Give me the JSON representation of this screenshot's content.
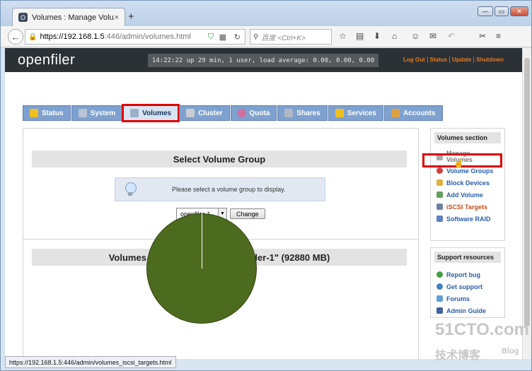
{
  "browser": {
    "tab_title": "Volumes : Manage Volu...",
    "tab_close": "×",
    "new_tab": "+",
    "url_host": "https://192.168.1.5",
    "url_path": ":446/admin/volumes.html",
    "search_placeholder": "百度 <Ctrl+K>",
    "status_url": "https://192.168.1.5:446/admin/volumes_iscsi_targets.html"
  },
  "header": {
    "logo": "openfiler",
    "uptime": "14:22:22 up 29 min, 1 user, load average: 0.00, 0.00, 0.00",
    "links": [
      "Log Out",
      "Status",
      "Update",
      "Shutdown"
    ]
  },
  "tabs": [
    {
      "label": "Status",
      "icon": "sun-icon",
      "color": "#f0c020"
    },
    {
      "label": "System",
      "icon": "computer-icon",
      "color": "#b8c4d4"
    },
    {
      "label": "Volumes",
      "icon": "disk-icon",
      "color": "#9ab0c8",
      "active": true
    },
    {
      "label": "Cluster",
      "icon": "cluster-icon",
      "color": "#c8ccd4"
    },
    {
      "label": "Quota",
      "icon": "pie-icon",
      "color": "#d070a0"
    },
    {
      "label": "Shares",
      "icon": "drive-icon",
      "color": "#b0b8c4"
    },
    {
      "label": "Services",
      "icon": "lightning-icon",
      "color": "#f0c020"
    },
    {
      "label": "Accounts",
      "icon": "users-icon",
      "color": "#e0a040"
    }
  ],
  "main": {
    "select_title": "Select Volume Group",
    "notice": "Please select a volume group to display.",
    "select_value": "openfiler-1",
    "change_button": "Change",
    "volumes_title": "Volumes in volume group \"openfiler-1\" (92880 MB)",
    "pie_color": "#4d6b1e"
  },
  "sidebar": {
    "volumes_title": "Volumes section",
    "volumes_items": [
      {
        "label": "Manage Volumes",
        "muted": true,
        "color": "#aaa"
      },
      {
        "label": "Volume Groups",
        "color": "#d04040"
      },
      {
        "label": "Block Devices",
        "color": "#e0b040"
      },
      {
        "label": "Add Volume",
        "color": "#60a060"
      },
      {
        "label": "iSCSI Targets",
        "color": "#7080a0"
      },
      {
        "label": "Software RAID",
        "color": "#6080c0"
      }
    ],
    "support_title": "Support resources",
    "support_items": [
      {
        "label": "Report bug",
        "color": "#40a040"
      },
      {
        "label": "Get support",
        "color": "#4080c0"
      },
      {
        "label": "Forums",
        "color": "#60a0d0"
      },
      {
        "label": "Admin Guide",
        "color": "#4060a0"
      }
    ]
  },
  "watermark": {
    "line1": "51CTO.com",
    "line2": "技术博客",
    "line3": "Blog"
  }
}
